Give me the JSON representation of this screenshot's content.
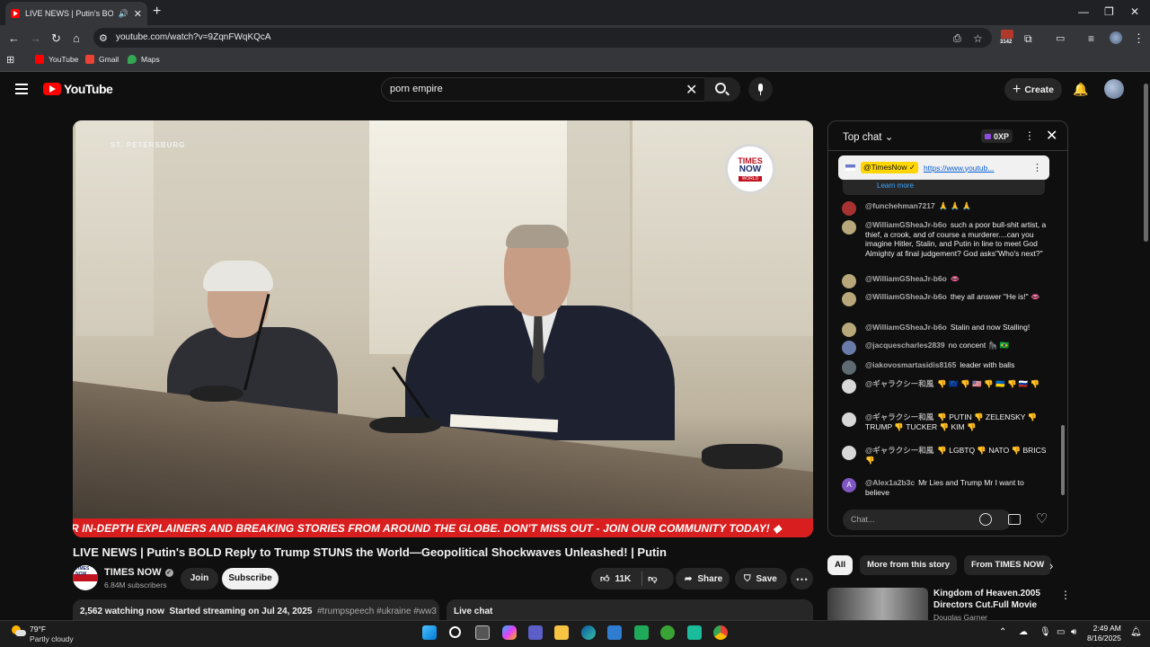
{
  "browser": {
    "tab_title": "LIVE NEWS | Putin's BOLD R",
    "url": "youtube.com/watch?v=9ZqnFWqKQcA",
    "extension_badge": "3142",
    "bookmarks": [
      {
        "label": "YouTube",
        "color": "#ff0000"
      },
      {
        "label": "Gmail",
        "color": "#ea4335"
      },
      {
        "label": "Maps",
        "color": "#34a853"
      }
    ]
  },
  "header": {
    "logo_text": "YouTube",
    "search_value": "porn empire",
    "create_label": "Create"
  },
  "video": {
    "location_text": "ST. PETERSBURG",
    "logo_line1": "TIMES",
    "logo_line2": "NOW",
    "logo_line3": "WORLD",
    "ticker_text": "R IN-DEPTH EXPLAINERS AND BREAKING STORIES FROM AROUND THE GLOBE. DON'T MISS OUT - JOIN OUR COMMUNITY TODAY! ◆",
    "title": "LIVE NEWS | Putin's BOLD Reply to Trump STUNS the World—Geopolitical Shockwaves Unleashed! | Putin"
  },
  "channel": {
    "avatar_text": "TIMES NOW",
    "name": "TIMES NOW",
    "subscribers": "6.84M subscribers",
    "join_label": "Join",
    "subscribe_label": "Subscribe"
  },
  "actions": {
    "likes": "11K",
    "share_label": "Share",
    "save_label": "Save"
  },
  "description": {
    "watching": "2,562 watching now",
    "started": "Started streaming on Jul 24, 2025",
    "tags": "#trumpspeech #ukraine #ww3"
  },
  "livechat_label": "Live chat",
  "chat": {
    "mode_label": "Top chat",
    "xp_label": "0XP",
    "pinned_tag": "@TimesNow ✓",
    "pinned_link": "https://www.youtub...",
    "learn_more": "Learn more",
    "messages": [
      {
        "author": "@funchehman7217",
        "text": "🙏 🙏 🙏",
        "color": "#a83232"
      },
      {
        "author": "@WilliamGSheaJr-b6o",
        "text": "such a poor bull-shit artist, a thief, a crook, and of course a murderer....can you imagine Hitler, Stalin, and Putin in line to meet God Almighty at final judgement? God asks\"Who's next?\"",
        "color": "#b8a77a"
      },
      {
        "author": "@WilliamGSheaJr-b6o",
        "text": "👄",
        "color": "#b8a77a"
      },
      {
        "author": "@WilliamGSheaJr-b6o",
        "text": "they all answer \"He is!\" 👄",
        "color": "#b8a77a"
      },
      {
        "author": "@WilliamGSheaJr-b6o",
        "text": "Stalin and now Stalling!",
        "color": "#b8a77a"
      },
      {
        "author": "@jacquescharles2839",
        "text": "no concent 🦍 🇧🇷",
        "color": "#6b7ba8"
      },
      {
        "author": "@iakovosmartasidis8165",
        "text": "leader with balls",
        "color": "#5f6b73"
      },
      {
        "author": "@ギャラクシー和風",
        "text": "👎 🇪🇺 👎 🇺🇸 👎 🇺🇦 👎 🇷🇺 👎",
        "color": "#d8d8d8"
      },
      {
        "author": "@ギャラクシー和風",
        "text": "👎 PUTIN 👎 ZELENSKY 👎 TRUMP 👎 TUCKER 👎 KIM 👎",
        "color": "#d8d8d8"
      },
      {
        "author": "@ギャラクシー和風",
        "text": "👎 LGBTQ 👎 NATO 👎 BRICS 👎",
        "color": "#d8d8d8"
      },
      {
        "author": "@Alex1a2b3c",
        "text": "Mr Lies and Trump Mr I want to believe",
        "color": "#7e57c2",
        "initial": "A"
      }
    ],
    "input_placeholder": "Chat..."
  },
  "related": {
    "chips": [
      "All",
      "More from this story",
      "From TIMES NOW"
    ],
    "item_title": "Kingdom of Heaven.2005 Directors Cut.Full Movie",
    "item_channel": "Douglas Garner"
  },
  "taskbar": {
    "temperature": "79°F",
    "condition": "Partly cloudy",
    "time": "2:49 AM",
    "date": "8/16/2025"
  }
}
